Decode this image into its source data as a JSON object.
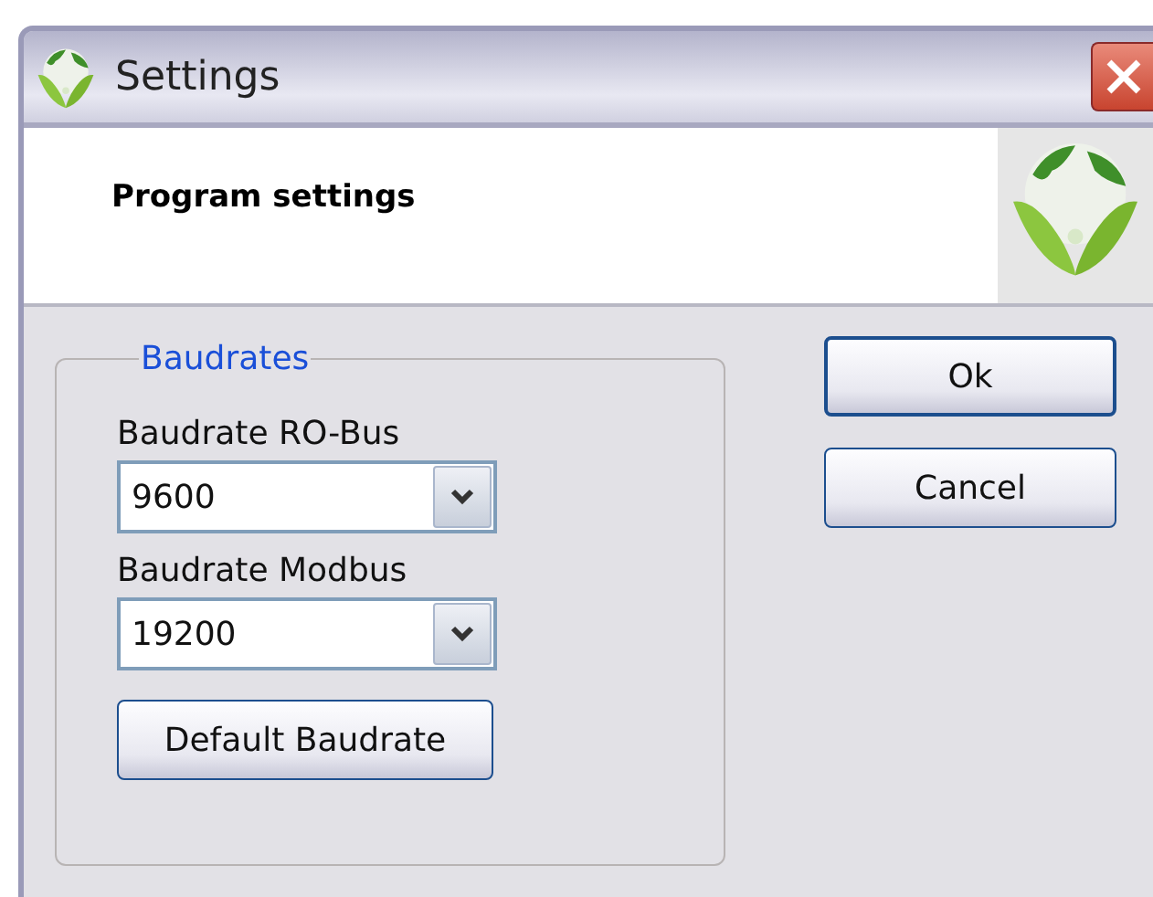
{
  "window": {
    "title": "Settings"
  },
  "header": {
    "title": "Program settings"
  },
  "group": {
    "title": "Baudrates",
    "fields": [
      {
        "label": "Baudrate RO-Bus",
        "value": "9600"
      },
      {
        "label": "Baudrate Modbus",
        "value": "19200"
      }
    ],
    "button": "Default Baudrate"
  },
  "buttons": [
    {
      "label": "Ok",
      "default": true
    },
    {
      "label": "Cancel",
      "default": false
    }
  ]
}
